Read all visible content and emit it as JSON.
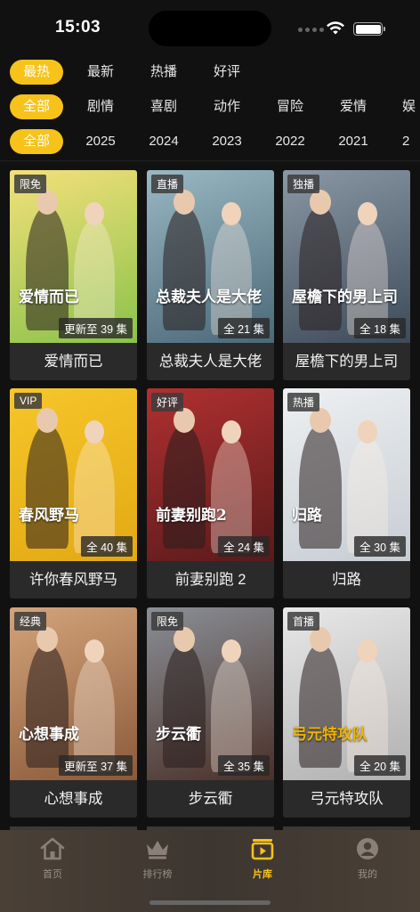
{
  "status": {
    "time": "15:03"
  },
  "filters": {
    "sort": [
      "最热",
      "最新",
      "热播",
      "好评"
    ],
    "genre": [
      "全部",
      "剧情",
      "喜剧",
      "动作",
      "冒险",
      "爱情",
      "娱"
    ],
    "year": [
      "全部",
      "2025",
      "2024",
      "2023",
      "2022",
      "2021",
      "2"
    ]
  },
  "cards": [
    {
      "title": "爱情而已",
      "tag": "限免",
      "episodes": "更新至 39 集",
      "poster_text": "爱情而已",
      "colors": [
        "#f3e07a",
        "#8ac24a"
      ]
    },
    {
      "title": "总裁夫人是大佬",
      "tag": "直播",
      "episodes": "全 21 集",
      "poster_text": "总裁夫人是大佬",
      "colors": [
        "#9ab8c2",
        "#4a6878"
      ]
    },
    {
      "title": "屋檐下的男上司",
      "tag": "独播",
      "episodes": "全 18 集",
      "poster_text": "屋檐下的男上司",
      "colors": [
        "#8a98a6",
        "#3d4a58"
      ]
    },
    {
      "title": "许你春风野马",
      "tag": "VIP",
      "episodes": "全 40 集",
      "poster_text": "春风野马",
      "colors": [
        "#f6c62a",
        "#e2a914"
      ]
    },
    {
      "title": "前妻别跑 2",
      "tag": "好评",
      "episodes": "全 24 集",
      "poster_text": "前妻别跑2",
      "colors": [
        "#b03030",
        "#5a1a1a"
      ]
    },
    {
      "title": "归路",
      "tag": "热播",
      "episodes": "全 30 集",
      "poster_text": "归路",
      "colors": [
        "#eef0f2",
        "#c6cdd3"
      ]
    },
    {
      "title": "心想事成",
      "tag": "经典",
      "episodes": "更新至 37 集",
      "poster_text": "心想事成",
      "colors": [
        "#d3a47a",
        "#8a5a3a"
      ]
    },
    {
      "title": "步云衢",
      "tag": "限免",
      "episodes": "全 35 集",
      "poster_text": "步云衢",
      "colors": [
        "#8a8f96",
        "#4a3028"
      ]
    },
    {
      "title": "弓元特攻队",
      "tag": "首播",
      "episodes": "全 20 集",
      "poster_text": "弓元特攻队",
      "colors": [
        "#e8e8e8",
        "#b0b0b0"
      ]
    }
  ],
  "tabs": [
    {
      "label": "首页",
      "icon": "home-icon"
    },
    {
      "label": "排行榜",
      "icon": "crown-icon"
    },
    {
      "label": "片库",
      "icon": "library-icon"
    },
    {
      "label": "我的",
      "icon": "profile-icon"
    }
  ],
  "accent_color": "#f7c21a"
}
